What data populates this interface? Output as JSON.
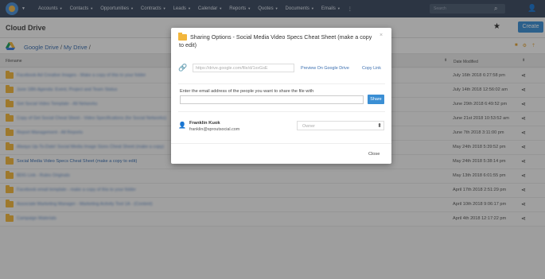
{
  "nav": {
    "items": [
      "Accounts",
      "Contacts",
      "Opportunities",
      "Contracts",
      "Leads",
      "Calendar",
      "Reports",
      "Quotes",
      "Documents",
      "Emails"
    ],
    "more": "⋮",
    "search_placeholder": "Search"
  },
  "header": {
    "title": "Cloud Drive",
    "create_label": "Create"
  },
  "breadcrumb": {
    "root": "Google Drive",
    "separator": " / ",
    "current": "My Drive",
    "trailing": " /"
  },
  "table": {
    "col_file": "Filename",
    "col_date": "Date Modified",
    "rows": [
      {
        "name": "Facebook Ad Creative Images - Make a copy of this to your folder",
        "date": "July 16th 2018 6:27:58 pm"
      },
      {
        "name": "June 18th Agenda: Event, Project and Team Status",
        "date": "July 14th 2018 12:56:02 am"
      },
      {
        "name": "Get Social Video Template - All Networks",
        "date": "June 29th 2018 6:49:52 pm"
      },
      {
        "name": "Copy of Get Social Cheat Sheet - Video Specifications (for Social Networks)",
        "date": "June 21st 2018 10:53:52 am"
      },
      {
        "name": "Report Management - All Reports",
        "date": "June 7th 2018 3:11:00 pm"
      },
      {
        "name": "Always Up-To-Date! Social Media Image Sizes Cheat Sheet (make a copy)",
        "date": "May 24th 2018 5:39:52 pm"
      },
      {
        "name": "Social Media Video Specs Cheat Sheet (make a copy to edit)",
        "date": "May 24th 2018 5:38:14 pm"
      },
      {
        "name": "BDG Link - Rules Originals",
        "date": "May 13th 2018 6:01:55 pm"
      },
      {
        "name": "Facebook email template - make a copy of this to your folder",
        "date": "April 17th 2018 2:51:29 pm"
      },
      {
        "name": "Associate Marketing Manager - Marketing Activity Tool 1A - (Content)",
        "date": "April 10th 2018 9:06:17 pm"
      },
      {
        "name": "Campaign Materials",
        "date": "April 4th 2018 12:17:22 pm"
      }
    ]
  },
  "modal": {
    "title": "Sharing Options - Social Media Video Specs Cheat Sheet (make a copy to edit)",
    "close_x": "×",
    "link_value": "https://drive.google.com/file/d/1xxGsE",
    "preview_label": "Preview On Google Drive",
    "copy_label": "Copy Link",
    "email_label": "Enter the email address of the people you want to share the file with",
    "share_label": "Share",
    "person_name": "Franklin Kuok",
    "person_email": "franklin@sproutsocial.com",
    "role": "Owner",
    "close_label": "Close"
  },
  "icons": {
    "accent": "#3b8fd4",
    "folder": "#f2b63c"
  }
}
